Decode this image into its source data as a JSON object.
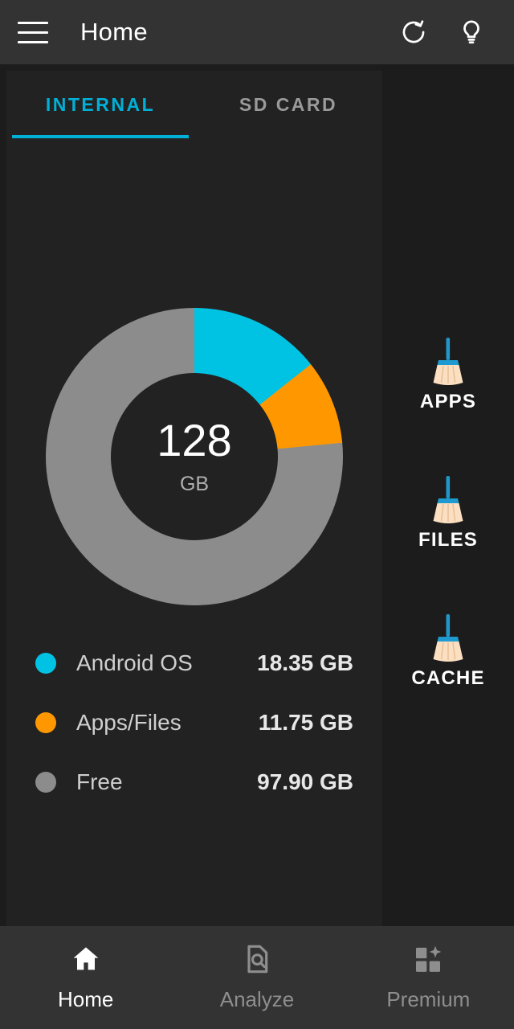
{
  "appbar": {
    "title": "Home",
    "menu_icon": "hamburger-menu-icon",
    "refresh_icon": "refresh-icon",
    "tip_icon": "lightbulb-icon"
  },
  "tabs": [
    {
      "label": "INTERNAL",
      "active": true
    },
    {
      "label": "SD CARD",
      "active": false
    }
  ],
  "storage": {
    "total_value": "128",
    "total_unit": "GB",
    "legend": [
      {
        "label": "Android OS",
        "value": "18.35 GB",
        "color": "#00c3e3"
      },
      {
        "label": "Apps/Files",
        "value": "11.75 GB",
        "color": "#ff9800"
      },
      {
        "label": "Free",
        "value": "97.90 GB",
        "color": "#8c8c8c"
      }
    ]
  },
  "clean_rail": [
    {
      "label": "APPS",
      "icon": "broom-icon"
    },
    {
      "label": "FILES",
      "icon": "broom-icon"
    },
    {
      "label": "CACHE",
      "icon": "broom-icon"
    }
  ],
  "bottom_nav": [
    {
      "label": "Home",
      "icon": "home-icon",
      "active": true
    },
    {
      "label": "Analyze",
      "icon": "document-search-icon",
      "active": false
    },
    {
      "label": "Premium",
      "icon": "squares-sparkle-icon",
      "active": false
    }
  ],
  "chart_data": {
    "type": "pie",
    "title": "Internal storage usage",
    "labels": [
      "Android OS",
      "Apps/Files",
      "Free"
    ],
    "values": [
      18.35,
      11.75,
      97.9
    ],
    "unit": "GB",
    "total": 128,
    "colors": [
      "#00c3e3",
      "#ff9800",
      "#8c8c8c"
    ],
    "legend": "bottom",
    "center_label": "128 GB"
  }
}
